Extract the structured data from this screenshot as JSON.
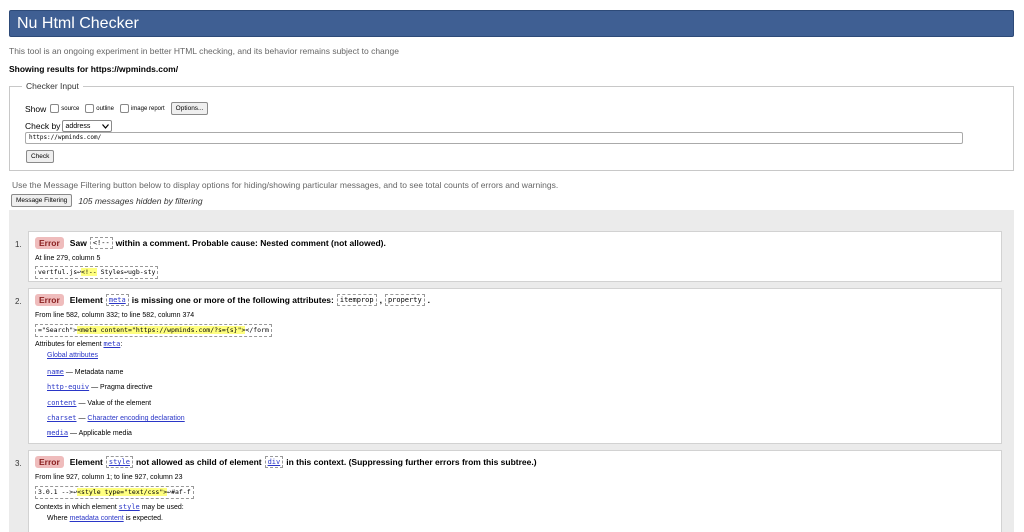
{
  "header": {
    "title": "Nu Html Checker"
  },
  "intro": "This tool is an ongoing experiment in better HTML checking, and its behavior remains subject to change",
  "showing": "Showing results for https://wpminds.com/",
  "checker_input": {
    "legend": "Checker Input",
    "show_label": "Show",
    "options": [
      "source",
      "outline",
      "image report"
    ],
    "options_button": "Options...",
    "check_by_label": "Check by",
    "check_by_value": "address",
    "address_value": "https://wpminds.com/",
    "check_button": "Check"
  },
  "filter": {
    "note": "Use the Message Filtering button below to display options for hiding/showing particular messages, and to see total counts of errors and warnings.",
    "button": "Message Filtering",
    "hidden": "105 messages hidden by filtering"
  },
  "messages": [
    {
      "num": "1.",
      "badge": "Error",
      "text_a": "Saw",
      "code_a": "<!--",
      "text_b": "within a comment. Probable cause: Nested comment (not allowed).",
      "location": "At line 279, column 5",
      "extract_pre": "vertful.js↩",
      "extract_hl": "<!--",
      "extract_post": " Styles↩ugb-sty"
    },
    {
      "num": "2.",
      "badge": "Error",
      "text_a": "Element",
      "code_a": "meta",
      "text_b": "is missing one or more of the following attributes:",
      "code_b": "itemprop",
      "sep": ",",
      "code_c": "property",
      "end": ".",
      "location": "From line 582, column 332; to line 582, column 374",
      "extract_pre": "=\"Search\">",
      "extract_hl": "<meta content=\"https://wpminds.com/?s={s}\">",
      "extract_post": "</form",
      "attr_head_text": "Attributes for element",
      "attr_head_code": "meta",
      "attr_head_colon": ":",
      "global_attrs": "Global attributes",
      "attrs": [
        {
          "name": "name",
          "desc": "— Metadata name"
        },
        {
          "name": "http-equiv",
          "desc": "— Pragma directive"
        },
        {
          "name": "content",
          "desc": "— Value of the element"
        },
        {
          "name": "charset",
          "desc": "—",
          "link": "Character encoding declaration"
        },
        {
          "name": "media",
          "desc": "— Applicable media"
        }
      ]
    },
    {
      "num": "3.",
      "badge": "Error",
      "text_a": "Element",
      "code_a": "style",
      "text_b": "not allowed as child of element",
      "code_b": "div",
      "text_c": "in this context. (Suppressing further errors from this subtree.)",
      "location": "From line 927, column 1; to line 927, column 23",
      "extract_pre": "3.0.1 -->↩",
      "extract_hl": "<style type=\"text/css\">",
      "extract_post": "↩#af-f",
      "ctx_text": "Contexts in which element",
      "ctx_code": "style",
      "ctx_end": "may be used:",
      "where_text": "Where",
      "where_link": "metadata content",
      "where_end": "is expected."
    }
  ]
}
